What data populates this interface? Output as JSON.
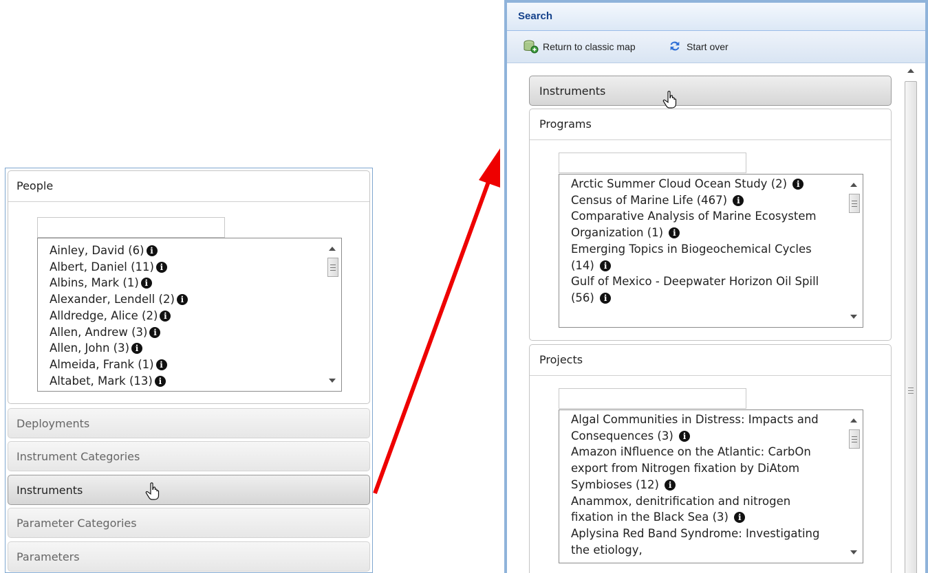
{
  "left": {
    "people_title": "People",
    "people_items": [
      {
        "label": "Ainley, David (6)"
      },
      {
        "label": "Albert, Daniel (11)"
      },
      {
        "label": "Albins, Mark (1)"
      },
      {
        "label": "Alexander, Lendell (2)"
      },
      {
        "label": "Alldredge, Alice (2)"
      },
      {
        "label": "Allen, Andrew (3)"
      },
      {
        "label": "Allen, John (3)"
      },
      {
        "label": "Almeida, Frank (1)"
      },
      {
        "label": "Altabet, Mark (13)"
      }
    ],
    "sections": [
      {
        "label": "Deployments"
      },
      {
        "label": "Instrument Categories"
      },
      {
        "label": "Instruments"
      },
      {
        "label": "Parameter Categories"
      },
      {
        "label": "Parameters"
      }
    ]
  },
  "window": {
    "title": "Search",
    "toolbar": {
      "return_label": "Return to classic map",
      "return_icon": "map-database-icon",
      "start_over_label": "Start over",
      "start_over_icon": "refresh-icon"
    },
    "instruments_label": "Instruments",
    "programs": {
      "title": "Programs",
      "items": [
        {
          "label": "Arctic Summer Cloud Ocean Study (2)"
        },
        {
          "label": "Census of Marine Life (467)"
        },
        {
          "label": "Comparative Analysis of Marine Ecosystem Organization (1)"
        },
        {
          "label": "Emerging Topics in Biogeochemical Cycles (14)"
        },
        {
          "label": "Gulf of Mexico - Deepwater Horizon Oil Spill (56)"
        }
      ]
    },
    "projects": {
      "title": "Projects",
      "items": [
        {
          "label": "Algal Communities in Distress: Impacts and Consequences (3)"
        },
        {
          "label": "Amazon iNfluence on the Atlantic: CarbOn export from Nitrogen fixation by DiAtom Symbioses (12)"
        },
        {
          "label": "Anammox, denitrification and nitrogen fixation in the Black Sea (3)"
        },
        {
          "label": "Aplysina Red Band Syndrome: Investigating the etiology,"
        }
      ]
    }
  },
  "info_glyph": "i",
  "colors": {
    "arrow": "#ee0000",
    "window_border": "#8fb3da",
    "title_text": "#15428b",
    "left_border": "#7ea6cf"
  }
}
